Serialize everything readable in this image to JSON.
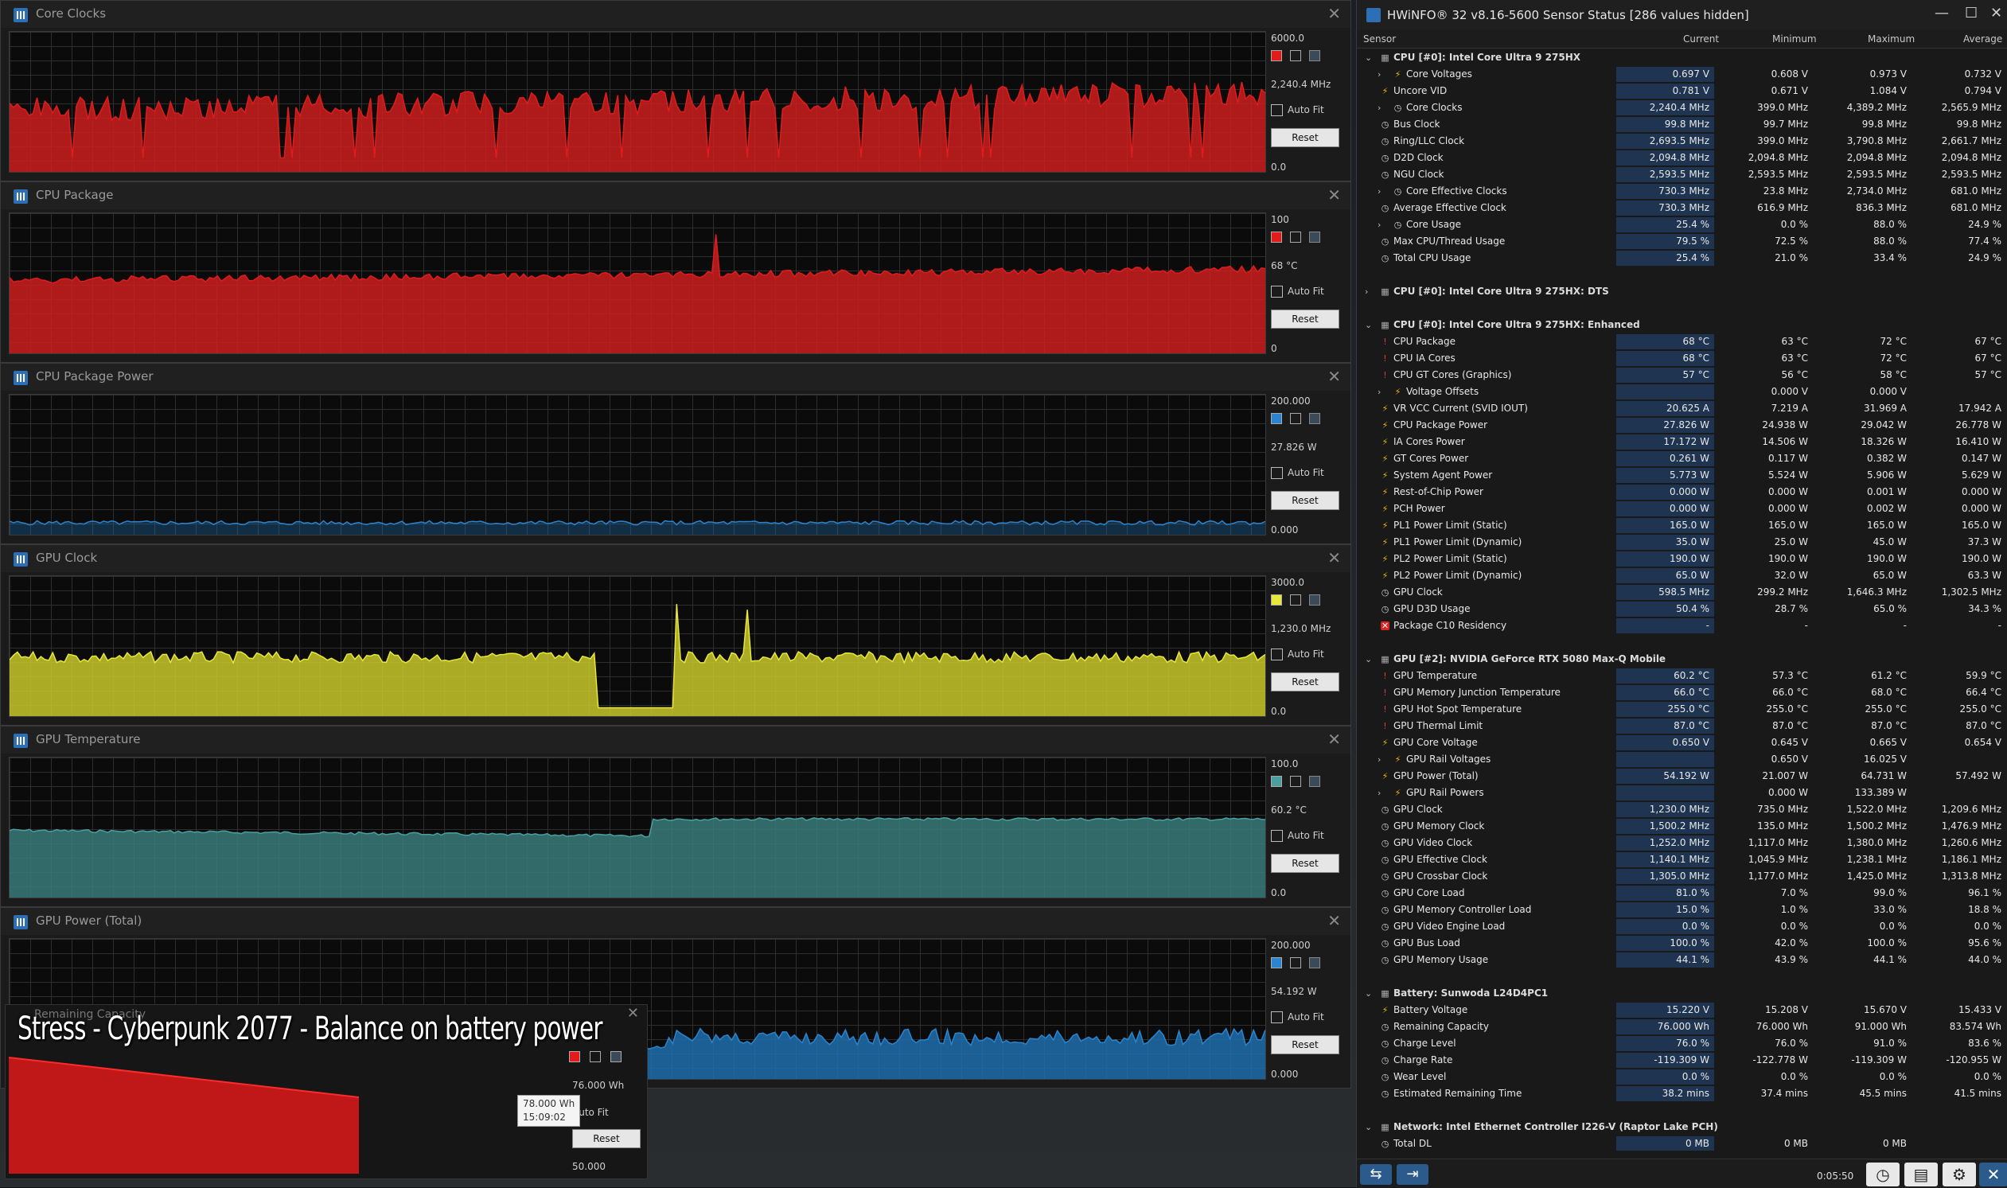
{
  "graphs": [
    {
      "title": "Core Clocks",
      "max": "6000.0",
      "current": "2,240.4 MHz",
      "min": "0.0",
      "color": "#cc1f1f",
      "swatch": "#e21b1b",
      "kind": "red_clock"
    },
    {
      "title": "CPU Package",
      "max": "100",
      "current": "68 °C",
      "min": "0",
      "color": "#cc1f1f",
      "swatch": "#e21b1b",
      "kind": "red_fill"
    },
    {
      "title": "CPU Package Power",
      "max": "200.000",
      "current": "27.826 W",
      "min": "0.000",
      "color": "#1f6fae",
      "swatch": "#2a84d0",
      "kind": "blue_low"
    },
    {
      "title": "GPU Clock",
      "max": "3000.0",
      "current": "1,230.0 MHz",
      "min": "0.0",
      "color": "#c8c82a",
      "swatch": "#e8e83a",
      "kind": "yellow"
    },
    {
      "title": "GPU Temperature",
      "max": "100.0",
      "current": "60.2 °C",
      "min": "0.0",
      "color": "#3a7a7a",
      "swatch": "#4aa0a0",
      "kind": "teal"
    },
    {
      "title": "GPU Power (Total)",
      "max": "200.000",
      "current": "54.192 W",
      "min": "0.000",
      "color": "#1f6fae",
      "swatch": "#2a84d0",
      "kind": "blue_mid"
    }
  ],
  "graph_controls": {
    "auto_fit": "Auto Fit",
    "reset": "Reset"
  },
  "overlay": {
    "title": "Remaining Capacity",
    "caption": "Stress - Cyberpunk 2077 - Balance on battery power",
    "current": "76.000 Wh",
    "min": "50.000",
    "auto_fit": "Auto Fit",
    "reset": "Reset",
    "tooltip_value": "78.000 Wh",
    "tooltip_time": "15:09:02"
  },
  "main": {
    "title": "HWiNFO® 32 v8.16-5600 Sensor Status [286 values hidden]",
    "columns": [
      "Sensor",
      "Current",
      "Minimum",
      "Maximum",
      "Average"
    ],
    "time": "0:05:50",
    "rows": [
      {
        "t": "g",
        "exp": "v",
        "name": "CPU [#0]: Intel Core Ultra 9 275HX"
      },
      {
        "t": "s",
        "exp": ">",
        "ic": "bolt",
        "name": "Core Voltages",
        "v": [
          "0.697 V",
          "0.608 V",
          "0.973 V",
          "0.732 V"
        ],
        "indent": 1
      },
      {
        "t": "s",
        "ic": "bolt",
        "name": "Uncore VID",
        "v": [
          "0.781 V",
          "0.671 V",
          "1.084 V",
          "0.794 V"
        ]
      },
      {
        "t": "s",
        "exp": ">",
        "ic": "clock",
        "name": "Core Clocks",
        "v": [
          "2,240.4 MHz",
          "399.0 MHz",
          "4,389.2 MHz",
          "2,565.9 MHz"
        ],
        "indent": 1
      },
      {
        "t": "s",
        "ic": "clock",
        "name": "Bus Clock",
        "v": [
          "99.8 MHz",
          "99.7 MHz",
          "99.8 MHz",
          "99.8 MHz"
        ]
      },
      {
        "t": "s",
        "ic": "clock",
        "name": "Ring/LLC Clock",
        "v": [
          "2,693.5 MHz",
          "399.0 MHz",
          "3,790.8 MHz",
          "2,661.7 MHz"
        ]
      },
      {
        "t": "s",
        "ic": "clock",
        "name": "D2D Clock",
        "v": [
          "2,094.8 MHz",
          "2,094.8 MHz",
          "2,094.8 MHz",
          "2,094.8 MHz"
        ]
      },
      {
        "t": "s",
        "ic": "clock",
        "name": "NGU Clock",
        "v": [
          "2,593.5 MHz",
          "2,593.5 MHz",
          "2,593.5 MHz",
          "2,593.5 MHz"
        ]
      },
      {
        "t": "s",
        "exp": ">",
        "ic": "clock",
        "name": "Core Effective Clocks",
        "v": [
          "730.3 MHz",
          "23.8 MHz",
          "2,734.0 MHz",
          "681.0 MHz"
        ],
        "indent": 1
      },
      {
        "t": "s",
        "ic": "clock",
        "name": "Average Effective Clock",
        "v": [
          "730.3 MHz",
          "616.9 MHz",
          "836.3 MHz",
          "681.0 MHz"
        ]
      },
      {
        "t": "s",
        "exp": ">",
        "ic": "clock",
        "name": "Core Usage",
        "v": [
          "25.4 %",
          "0.0 %",
          "88.0 %",
          "24.9 %"
        ],
        "indent": 1
      },
      {
        "t": "s",
        "ic": "clock",
        "name": "Max CPU/Thread Usage",
        "v": [
          "79.5 %",
          "72.5 %",
          "88.0 %",
          "77.4 %"
        ]
      },
      {
        "t": "s",
        "ic": "clock",
        "name": "Total CPU Usage",
        "v": [
          "25.4 %",
          "21.0 %",
          "33.4 %",
          "24.9 %"
        ]
      },
      {
        "t": "e"
      },
      {
        "t": "g",
        "exp": ">",
        "name": "CPU [#0]: Intel Core Ultra 9 275HX: DTS"
      },
      {
        "t": "e"
      },
      {
        "t": "g",
        "exp": "v",
        "name": "CPU [#0]: Intel Core Ultra 9 275HX: Enhanced"
      },
      {
        "t": "s",
        "ic": "therm",
        "name": "CPU Package",
        "v": [
          "68 °C",
          "63 °C",
          "72 °C",
          "67 °C"
        ]
      },
      {
        "t": "s",
        "ic": "therm",
        "name": "CPU IA Cores",
        "v": [
          "68 °C",
          "63 °C",
          "72 °C",
          "67 °C"
        ]
      },
      {
        "t": "s",
        "ic": "therm",
        "name": "CPU GT Cores (Graphics)",
        "v": [
          "57 °C",
          "56 °C",
          "58 °C",
          "57 °C"
        ]
      },
      {
        "t": "s",
        "exp": ">",
        "ic": "bolt",
        "name": "Voltage Offsets",
        "v": [
          "",
          "0.000 V",
          "0.000 V",
          ""
        ],
        "indent": 1
      },
      {
        "t": "s",
        "ic": "bolt",
        "name": "VR VCC Current (SVID IOUT)",
        "v": [
          "20.625 A",
          "7.219 A",
          "31.969 A",
          "17.942 A"
        ]
      },
      {
        "t": "s",
        "ic": "bolt",
        "name": "CPU Package Power",
        "v": [
          "27.826 W",
          "24.938 W",
          "29.042 W",
          "26.778 W"
        ]
      },
      {
        "t": "s",
        "ic": "bolt",
        "name": "IA Cores Power",
        "v": [
          "17.172 W",
          "14.506 W",
          "18.326 W",
          "16.410 W"
        ]
      },
      {
        "t": "s",
        "ic": "bolt",
        "name": "GT Cores Power",
        "v": [
          "0.261 W",
          "0.117 W",
          "0.382 W",
          "0.147 W"
        ]
      },
      {
        "t": "s",
        "ic": "bolt",
        "name": "System Agent Power",
        "v": [
          "5.773 W",
          "5.524 W",
          "5.906 W",
          "5.629 W"
        ]
      },
      {
        "t": "s",
        "ic": "bolt",
        "name": "Rest-of-Chip Power",
        "v": [
          "0.000 W",
          "0.000 W",
          "0.001 W",
          "0.000 W"
        ]
      },
      {
        "t": "s",
        "ic": "bolt",
        "name": "PCH Power",
        "v": [
          "0.000 W",
          "0.000 W",
          "0.002 W",
          "0.000 W"
        ]
      },
      {
        "t": "s",
        "ic": "bolt",
        "name": "PL1 Power Limit (Static)",
        "v": [
          "165.0 W",
          "165.0 W",
          "165.0 W",
          "165.0 W"
        ]
      },
      {
        "t": "s",
        "ic": "bolt",
        "name": "PL1 Power Limit (Dynamic)",
        "v": [
          "35.0 W",
          "25.0 W",
          "45.0 W",
          "37.3 W"
        ]
      },
      {
        "t": "s",
        "ic": "bolt",
        "name": "PL2 Power Limit (Static)",
        "v": [
          "190.0 W",
          "190.0 W",
          "190.0 W",
          "190.0 W"
        ]
      },
      {
        "t": "s",
        "ic": "bolt",
        "name": "PL2 Power Limit (Dynamic)",
        "v": [
          "65.0 W",
          "32.0 W",
          "65.0 W",
          "63.3 W"
        ]
      },
      {
        "t": "s",
        "ic": "clock",
        "name": "GPU Clock",
        "v": [
          "598.5 MHz",
          "299.2 MHz",
          "1,646.3 MHz",
          "1,302.5 MHz"
        ]
      },
      {
        "t": "s",
        "ic": "clock",
        "name": "GPU D3D Usage",
        "v": [
          "50.4 %",
          "28.7 %",
          "65.0 %",
          "34.3 %"
        ]
      },
      {
        "t": "s",
        "ic": "x",
        "name": "Package C10 Residency",
        "v": [
          "-",
          "-",
          "-",
          "-"
        ]
      },
      {
        "t": "e"
      },
      {
        "t": "g",
        "exp": "v",
        "name": "GPU [#2]: NVIDIA  GeForce RTX 5080 Max-Q Mobile"
      },
      {
        "t": "s",
        "ic": "therm",
        "name": "GPU Temperature",
        "v": [
          "60.2 °C",
          "57.3 °C",
          "61.2 °C",
          "59.9 °C"
        ]
      },
      {
        "t": "s",
        "ic": "therm",
        "name": "GPU Memory Junction Temperature",
        "v": [
          "66.0 °C",
          "66.0 °C",
          "68.0 °C",
          "66.4 °C"
        ]
      },
      {
        "t": "s",
        "ic": "therm",
        "name": "GPU Hot Spot Temperature",
        "v": [
          "255.0 °C",
          "255.0 °C",
          "255.0 °C",
          "255.0 °C"
        ]
      },
      {
        "t": "s",
        "ic": "therm",
        "name": "GPU Thermal Limit",
        "v": [
          "87.0 °C",
          "87.0 °C",
          "87.0 °C",
          "87.0 °C"
        ]
      },
      {
        "t": "s",
        "ic": "bolt",
        "name": "GPU Core Voltage",
        "v": [
          "0.650 V",
          "0.645 V",
          "0.665 V",
          "0.654 V"
        ]
      },
      {
        "t": "s",
        "exp": ">",
        "ic": "bolt",
        "name": "GPU Rail Voltages",
        "v": [
          "",
          "0.650 V",
          "16.025 V",
          ""
        ],
        "indent": 1
      },
      {
        "t": "s",
        "ic": "bolt",
        "name": "GPU Power (Total)",
        "v": [
          "54.192 W",
          "21.007 W",
          "64.731 W",
          "57.492 W"
        ]
      },
      {
        "t": "s",
        "exp": ">",
        "ic": "bolt",
        "name": "GPU Rail Powers",
        "v": [
          "",
          "0.000 W",
          "133.389 W",
          ""
        ],
        "indent": 1
      },
      {
        "t": "s",
        "ic": "clock",
        "name": "GPU Clock",
        "v": [
          "1,230.0 MHz",
          "735.0 MHz",
          "1,522.0 MHz",
          "1,209.6 MHz"
        ]
      },
      {
        "t": "s",
        "ic": "clock",
        "name": "GPU Memory Clock",
        "v": [
          "1,500.2 MHz",
          "135.0 MHz",
          "1,500.2 MHz",
          "1,476.9 MHz"
        ]
      },
      {
        "t": "s",
        "ic": "clock",
        "name": "GPU Video Clock",
        "v": [
          "1,252.0 MHz",
          "1,117.0 MHz",
          "1,380.0 MHz",
          "1,260.6 MHz"
        ]
      },
      {
        "t": "s",
        "ic": "clock",
        "name": "GPU Effective Clock",
        "v": [
          "1,140.1 MHz",
          "1,045.9 MHz",
          "1,238.1 MHz",
          "1,186.1 MHz"
        ]
      },
      {
        "t": "s",
        "ic": "clock",
        "name": "GPU Crossbar Clock",
        "v": [
          "1,305.0 MHz",
          "1,177.0 MHz",
          "1,425.0 MHz",
          "1,313.8 MHz"
        ]
      },
      {
        "t": "s",
        "ic": "clock",
        "name": "GPU Core Load",
        "v": [
          "81.0 %",
          "7.0 %",
          "99.0 %",
          "96.1 %"
        ]
      },
      {
        "t": "s",
        "ic": "clock",
        "name": "GPU Memory Controller Load",
        "v": [
          "15.0 %",
          "1.0 %",
          "33.0 %",
          "18.8 %"
        ]
      },
      {
        "t": "s",
        "ic": "clock",
        "name": "GPU Video Engine Load",
        "v": [
          "0.0 %",
          "0.0 %",
          "0.0 %",
          "0.0 %"
        ]
      },
      {
        "t": "s",
        "ic": "clock",
        "name": "GPU Bus Load",
        "v": [
          "100.0 %",
          "42.0 %",
          "100.0 %",
          "95.6 %"
        ]
      },
      {
        "t": "s",
        "ic": "clock",
        "name": "GPU Memory Usage",
        "v": [
          "44.1 %",
          "43.9 %",
          "44.1 %",
          "44.0 %"
        ]
      },
      {
        "t": "e"
      },
      {
        "t": "g",
        "exp": "v",
        "name": "Battery: Sunwoda L24D4PC1"
      },
      {
        "t": "s",
        "ic": "bolt",
        "name": "Battery Voltage",
        "v": [
          "15.220 V",
          "15.208 V",
          "15.670 V",
          "15.433 V"
        ]
      },
      {
        "t": "s",
        "ic": "clock",
        "name": "Remaining Capacity",
        "v": [
          "76.000 Wh",
          "76.000 Wh",
          "91.000 Wh",
          "83.574 Wh"
        ]
      },
      {
        "t": "s",
        "ic": "clock",
        "name": "Charge Level",
        "v": [
          "76.0 %",
          "76.0 %",
          "91.0 %",
          "83.6 %"
        ]
      },
      {
        "t": "s",
        "ic": "clock",
        "name": "Charge Rate",
        "v": [
          "-119.309 W",
          "-122.778 W",
          "-119.309 W",
          "-120.955 W"
        ]
      },
      {
        "t": "s",
        "ic": "clock",
        "name": "Wear Level",
        "v": [
          "0.0 %",
          "0.0 %",
          "0.0 %",
          "0.0 %"
        ]
      },
      {
        "t": "s",
        "ic": "clock",
        "name": "Estimated Remaining Time",
        "v": [
          "38.2 mins",
          "37.4 mins",
          "45.5 mins",
          "41.5 mins"
        ]
      },
      {
        "t": "e"
      },
      {
        "t": "g",
        "exp": "v",
        "name": "Network: Intel Ethernet Controller I226-V (Raptor Lake PCH)"
      },
      {
        "t": "s",
        "ic": "clock",
        "name": "Total DL",
        "v": [
          "0 MB",
          "0 MB",
          "0 MB",
          ""
        ]
      }
    ]
  }
}
